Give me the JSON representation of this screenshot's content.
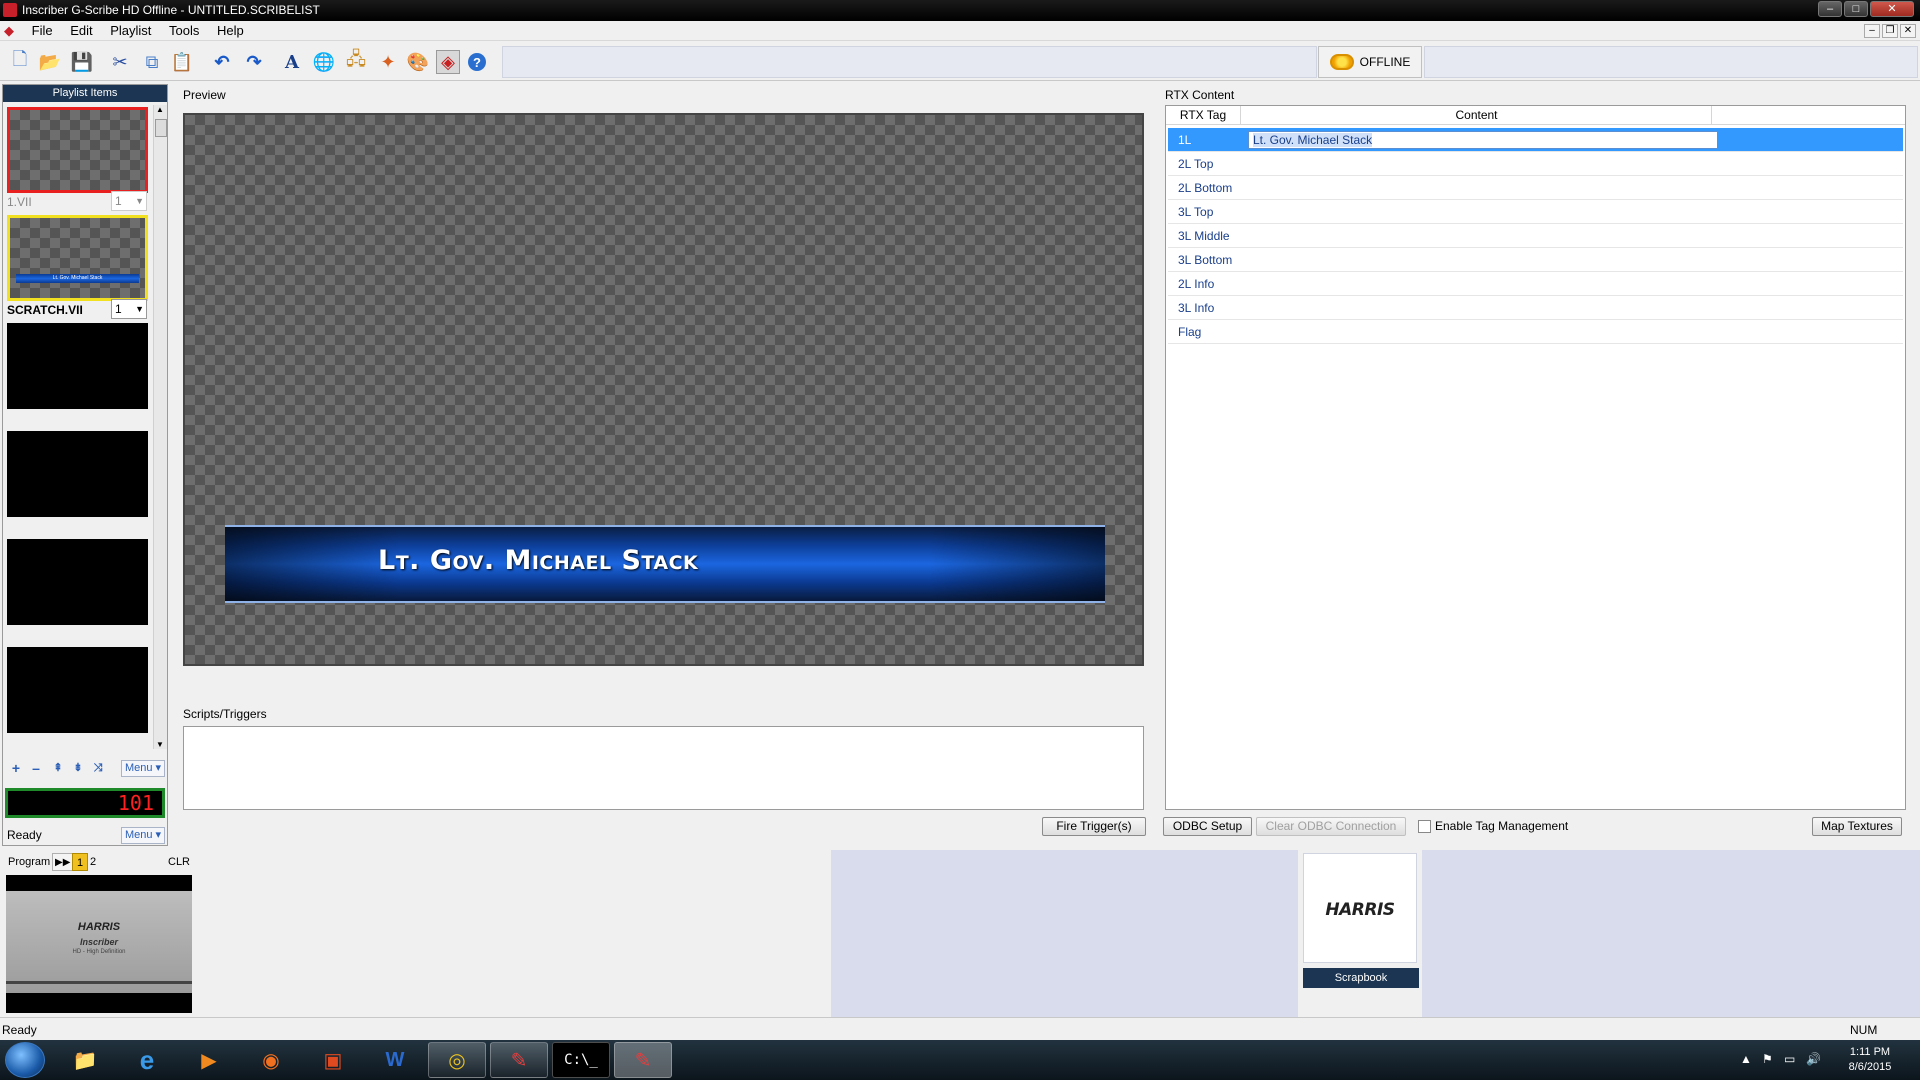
{
  "window": {
    "title": "Inscriber G-Scribe HD Offline - UNTITLED.SCRIBELIST",
    "minimize": "–",
    "maximize": "□",
    "close": "✕"
  },
  "menu": {
    "items": [
      "File",
      "Edit",
      "Playlist",
      "Tools",
      "Help"
    ],
    "mdi_min": "–",
    "mdi_restore": "❐",
    "mdi_close": "✕"
  },
  "toolbar": {
    "icons": [
      "new-icon",
      "open-icon",
      "save-icon",
      "cut-icon",
      "copy-icon",
      "paste-icon",
      "undo-icon",
      "redo-icon",
      "text-icon",
      "globe-icon",
      "network-icon",
      "effects-icon",
      "palette-icon",
      "cube-icon",
      "help-icon"
    ],
    "offline_label": "OFFLINE"
  },
  "playlist": {
    "header": "Playlist Items",
    "item1_name": "1.VII",
    "item1_value": "1",
    "item2_name": "SCRATCH.VII",
    "item2_value": "1",
    "item2_thumb_text": "Lt. Gov. Michael Stack",
    "menu_label": "Menu ▾",
    "counter": "101",
    "status": "Ready",
    "menu_label2": "Menu ▾"
  },
  "preview": {
    "label": "Preview",
    "lower_third_text": "Lt. Gov. Michael Stack"
  },
  "scripts": {
    "label": "Scripts/Triggers",
    "fire_button": "Fire Trigger(s)"
  },
  "rtx": {
    "label": "RTX Content",
    "col_tag": "RTX Tag",
    "col_content": "Content",
    "rows": [
      {
        "tag": "1L",
        "content": "Lt. Gov. Michael Stack"
      },
      {
        "tag": "2L Top",
        "content": ""
      },
      {
        "tag": "2L Bottom",
        "content": ""
      },
      {
        "tag": "3L Top",
        "content": ""
      },
      {
        "tag": "3L Middle",
        "content": ""
      },
      {
        "tag": "3L Bottom",
        "content": ""
      },
      {
        "tag": "2L Info",
        "content": ""
      },
      {
        "tag": "3L Info",
        "content": ""
      },
      {
        "tag": "Flag",
        "content": ""
      }
    ],
    "odbc_setup": "ODBC Setup",
    "clear_odbc": "Clear ODBC Connection",
    "enable_tag_mgmt": "Enable Tag Management",
    "map_textures": "Map Textures"
  },
  "program": {
    "label": "Program",
    "tab1": "1",
    "tab2": "2",
    "clr": "CLR",
    "thumb_brand": "HARRIS",
    "thumb_product": "Inscriber",
    "thumb_sub": "HD - High Definition"
  },
  "scrapbook": {
    "logo": "HARRIS",
    "label": "Scrapbook"
  },
  "statusbar": {
    "left": "Ready",
    "num": "NUM"
  },
  "taskbar": {
    "time": "1:11 PM",
    "date": "8/6/2015",
    "apps": [
      "explorer-icon",
      "ie-icon",
      "media-player-icon",
      "firefox-icon",
      "presentation-icon",
      "word-icon",
      "chrome-icon",
      "inscriber-icon",
      "cmd-icon",
      "inscriber-icon-2"
    ]
  }
}
